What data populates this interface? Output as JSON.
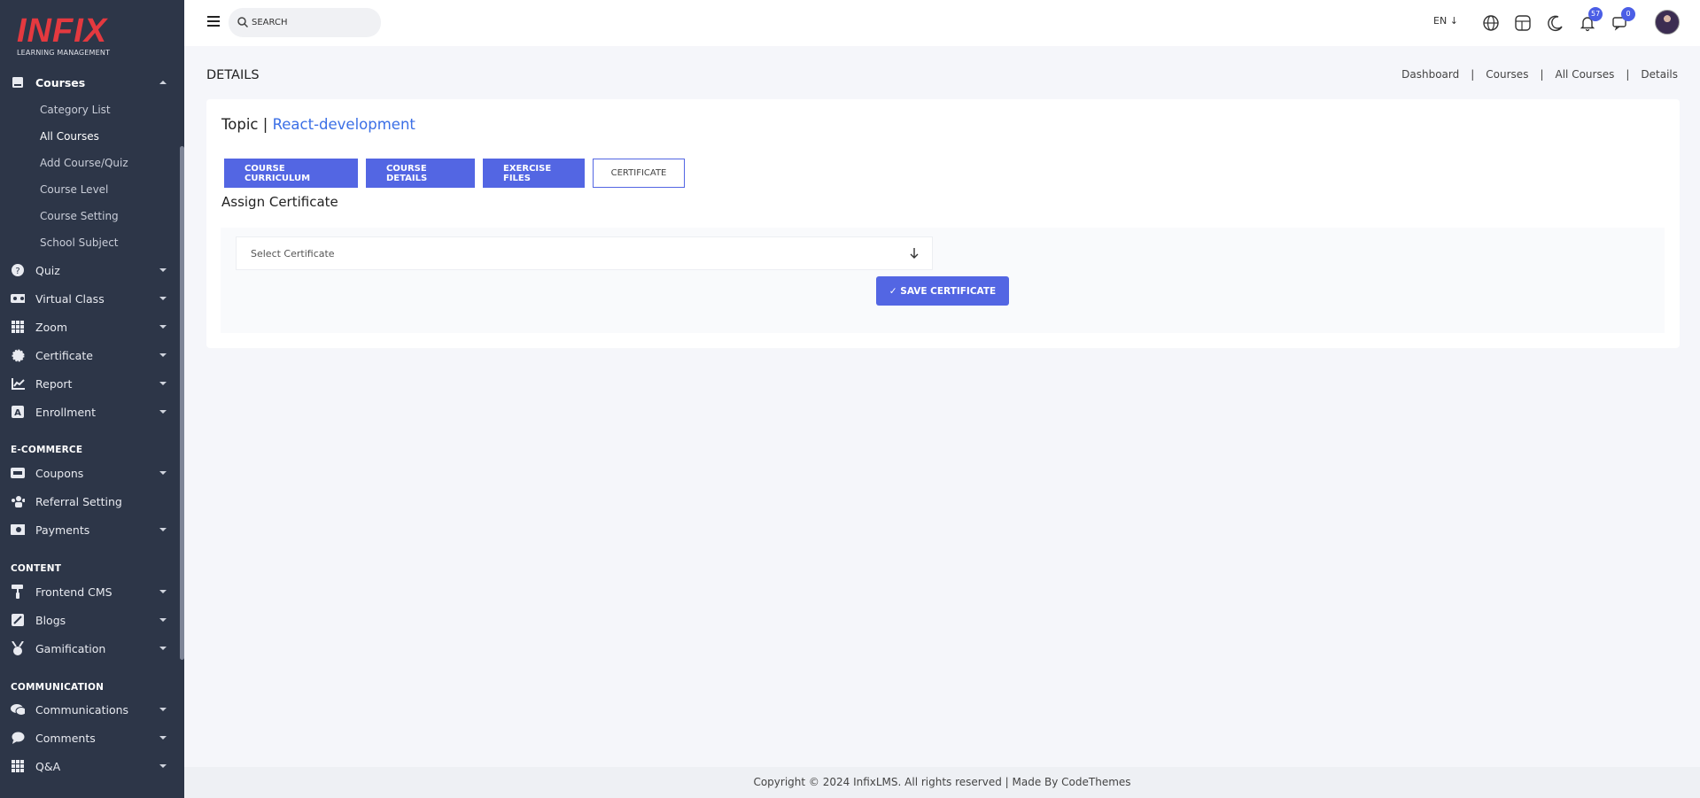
{
  "brand": {
    "name": "INFIX",
    "tagline": "LEARNING MANAGEMENT"
  },
  "sidebar": {
    "courses": {
      "label": "Courses",
      "icon": "book-icon"
    },
    "sub_items": [
      "Category List",
      "All Courses",
      "Add Course/Quiz",
      "Course Level",
      "Course Setting",
      "School Subject"
    ],
    "active_sub": "All Courses",
    "items": [
      {
        "label": "Quiz",
        "icon": "question-icon"
      },
      {
        "label": "Virtual Class",
        "icon": "vr-icon"
      },
      {
        "label": "Zoom",
        "icon": "grid-icon"
      },
      {
        "label": "Certificate",
        "icon": "badge-icon"
      },
      {
        "label": "Report",
        "icon": "chart-icon"
      },
      {
        "label": "Enrollment",
        "icon": "enroll-icon"
      }
    ],
    "section_ecommerce": "E-COMMERCE",
    "ecommerce": [
      {
        "label": "Coupons",
        "icon": "ticket-icon"
      },
      {
        "label": "Referral Setting",
        "icon": "users-icon"
      },
      {
        "label": "Payments",
        "icon": "money-icon"
      }
    ],
    "section_content": "CONTENT",
    "content": [
      {
        "label": "Frontend CMS",
        "icon": "paint-roller-icon"
      },
      {
        "label": "Blogs",
        "icon": "pen-icon"
      },
      {
        "label": "Gamification",
        "icon": "medal-icon"
      }
    ],
    "section_communication": "COMMUNICATION",
    "communication": [
      {
        "label": "Communications",
        "icon": "chat-icon"
      },
      {
        "label": "Comments",
        "icon": "comment-icon"
      },
      {
        "label": "Q&A",
        "icon": "grid-icon"
      }
    ]
  },
  "header": {
    "search_placeholder": "SEARCH",
    "language": "EN",
    "notifications_count": "57",
    "messages_count": "0"
  },
  "page": {
    "title": "DETAILS",
    "breadcrumb": [
      "Dashboard",
      "Courses",
      "All Courses",
      "Details"
    ]
  },
  "card": {
    "topic_prefix": "Topic | ",
    "topic_name": "React-development",
    "tabs": [
      "COURSE CURRICULUM",
      "COURSE DETAILS",
      "EXERCISE FILES",
      "CERTIFICATE"
    ],
    "active_tab": "CERTIFICATE",
    "section_title": "Assign Certificate",
    "select_placeholder": "Select Certificate",
    "save_label": "✓ SAVE CERTIFICATE"
  },
  "footer": {
    "text": "Copyright © 2024 InfixLMS. All rights reserved | Made By CodeThemes"
  },
  "colors": {
    "sidebar_bg": "#2D3648",
    "primary": "#5366e3",
    "brand_red": "#e4393f",
    "link": "#3b6fe6"
  }
}
